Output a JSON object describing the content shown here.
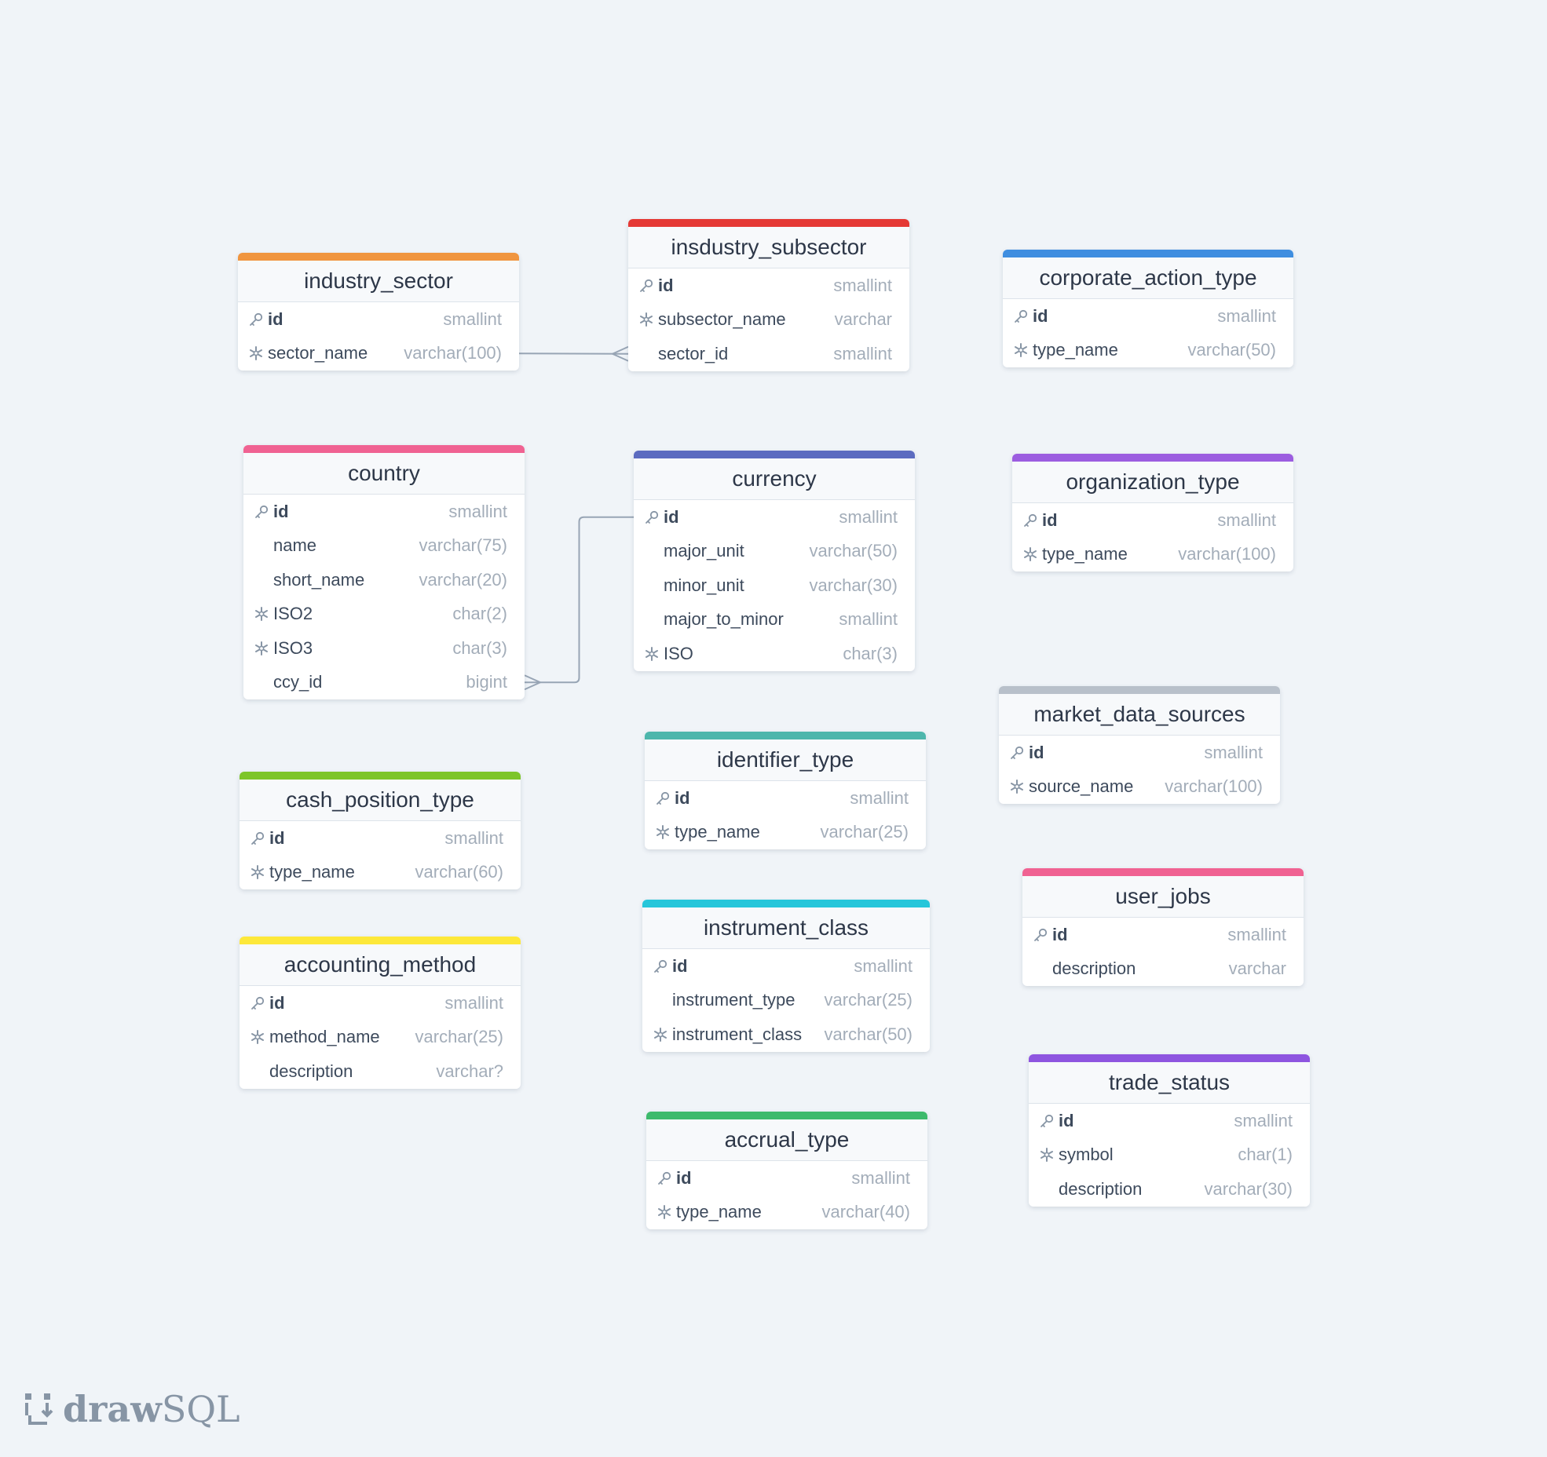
{
  "brand": {
    "logo_bold": "draw",
    "logo_light": "SQL"
  },
  "tables": [
    {
      "name": "industry_sector",
      "color": "#f0953f",
      "columns": [
        {
          "name": "id",
          "type": "smallint",
          "key": "pk"
        },
        {
          "name": "sector_name",
          "type": "varchar(100)",
          "key": "unique"
        }
      ]
    },
    {
      "name": "insdustry_subsector",
      "color": "#e53935",
      "columns": [
        {
          "name": "id",
          "type": "smallint",
          "key": "pk"
        },
        {
          "name": "subsector_name",
          "type": "varchar",
          "key": "unique"
        },
        {
          "name": "sector_id",
          "type": "smallint",
          "key": ""
        }
      ]
    },
    {
      "name": "corporate_action_type",
      "color": "#3f8ee0",
      "columns": [
        {
          "name": "id",
          "type": "smallint",
          "key": "pk"
        },
        {
          "name": "type_name",
          "type": "varchar(50)",
          "key": "unique"
        }
      ]
    },
    {
      "name": "country",
      "color": "#f06292",
      "columns": [
        {
          "name": "id",
          "type": "smallint",
          "key": "pk"
        },
        {
          "name": "name",
          "type": "varchar(75)",
          "key": ""
        },
        {
          "name": "short_name",
          "type": "varchar(20)",
          "key": ""
        },
        {
          "name": "ISO2",
          "type": "char(2)",
          "key": "unique"
        },
        {
          "name": "ISO3",
          "type": "char(3)",
          "key": "unique"
        },
        {
          "name": "ccy_id",
          "type": "bigint",
          "key": ""
        }
      ]
    },
    {
      "name": "currency",
      "color": "#5c6bc0",
      "columns": [
        {
          "name": "id",
          "type": "smallint",
          "key": "pk"
        },
        {
          "name": "major_unit",
          "type": "varchar(50)",
          "key": ""
        },
        {
          "name": "minor_unit",
          "type": "varchar(30)",
          "key": ""
        },
        {
          "name": "major_to_minor",
          "type": "smallint",
          "key": ""
        },
        {
          "name": "ISO",
          "type": "char(3)",
          "key": "unique"
        }
      ]
    },
    {
      "name": "organization_type",
      "color": "#9c5de0",
      "columns": [
        {
          "name": "id",
          "type": "smallint",
          "key": "pk"
        },
        {
          "name": "type_name",
          "type": "varchar(100)",
          "key": "unique"
        }
      ]
    },
    {
      "name": "market_data_sources",
      "color": "#b8c0ca",
      "columns": [
        {
          "name": "id",
          "type": "smallint",
          "key": "pk"
        },
        {
          "name": "source_name",
          "type": "varchar(100)",
          "key": "unique"
        }
      ]
    },
    {
      "name": "cash_position_type",
      "color": "#7dc52a",
      "columns": [
        {
          "name": "id",
          "type": "smallint",
          "key": "pk"
        },
        {
          "name": "type_name",
          "type": "varchar(60)",
          "key": "unique"
        }
      ]
    },
    {
      "name": "identifier_type",
      "color": "#4db6ac",
      "columns": [
        {
          "name": "id",
          "type": "smallint",
          "key": "pk"
        },
        {
          "name": "type_name",
          "type": "varchar(25)",
          "key": "unique"
        }
      ]
    },
    {
      "name": "user_jobs",
      "color": "#f06292",
      "columns": [
        {
          "name": "id",
          "type": "smallint",
          "key": "pk"
        },
        {
          "name": "description",
          "type": "varchar",
          "key": ""
        }
      ]
    },
    {
      "name": "accounting_method",
      "color": "#fde83a",
      "columns": [
        {
          "name": "id",
          "type": "smallint",
          "key": "pk"
        },
        {
          "name": "method_name",
          "type": "varchar(25)",
          "key": "unique"
        },
        {
          "name": "description",
          "type": "varchar?",
          "key": ""
        }
      ]
    },
    {
      "name": "instrument_class",
      "color": "#26c6da",
      "columns": [
        {
          "name": "id",
          "type": "smallint",
          "key": "pk"
        },
        {
          "name": "instrument_type",
          "type": "varchar(25)",
          "key": ""
        },
        {
          "name": "instrument_class",
          "type": "varchar(50)",
          "key": "unique"
        }
      ]
    },
    {
      "name": "trade_status",
      "color": "#8e55e0",
      "columns": [
        {
          "name": "id",
          "type": "smallint",
          "key": "pk"
        },
        {
          "name": "symbol",
          "type": "char(1)",
          "key": "unique"
        },
        {
          "name": "description",
          "type": "varchar(30)",
          "key": ""
        }
      ]
    },
    {
      "name": "accrual_type",
      "color": "#3dba6c",
      "columns": [
        {
          "name": "id",
          "type": "smallint",
          "key": "pk"
        },
        {
          "name": "type_name",
          "type": "varchar(40)",
          "key": "unique"
        }
      ]
    }
  ],
  "relationships": [
    {
      "from": "industry_sector.sector_name",
      "to": "insdustry_subsector.sector_id",
      "cardinality": "one-to-many"
    },
    {
      "from": "currency.id",
      "to": "country.ccy_id",
      "cardinality": "one-to-many"
    }
  ]
}
